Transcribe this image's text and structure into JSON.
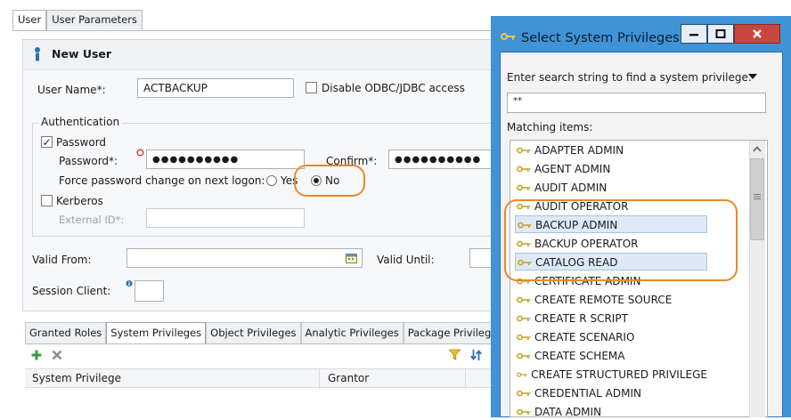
{
  "top_tabs": [
    {
      "label": "User",
      "active": true
    },
    {
      "label": "User Parameters",
      "active": false
    }
  ],
  "editor": {
    "title": "New User",
    "user_name_label": "User Name*:",
    "user_name_value": "ACTBACKUP",
    "disable_odbc_label": "Disable ODBC/JDBC access",
    "auth_group_label": "Authentication",
    "password_check_label": "Password",
    "password_label": "Password*:",
    "password_value": "●●●●●●●●●●",
    "confirm_label": "Confirm*:",
    "confirm_value": "●●●●●●●●●●",
    "force_change_label": "Force password change on next logon:",
    "yes_label": "Yes",
    "no_label": "No",
    "kerberos_label": "Kerberos",
    "external_id_label": "External ID*:",
    "valid_from_label": "Valid From:",
    "valid_until_label": "Valid Until:",
    "session_client_label": "Session Client:"
  },
  "bottom_tabs": [
    {
      "label": "Granted Roles",
      "active": false
    },
    {
      "label": "System Privileges",
      "active": true
    },
    {
      "label": "Object Privileges",
      "active": false
    },
    {
      "label": "Analytic Privileges",
      "active": false
    },
    {
      "label": "Package Privileg",
      "active": false
    }
  ],
  "grid": {
    "columns": [
      "System Privilege",
      "Grantor"
    ]
  },
  "dialog": {
    "title": "Select System Privileges",
    "search_prompt": "Enter search string to find a system privilege.",
    "search_value": "**",
    "matching_label": "Matching items:",
    "items": [
      {
        "label": "ADAPTER ADMIN",
        "selected": false
      },
      {
        "label": "AGENT ADMIN",
        "selected": false
      },
      {
        "label": "AUDIT ADMIN",
        "selected": false
      },
      {
        "label": "AUDIT OPERATOR",
        "selected": false
      },
      {
        "label": "BACKUP ADMIN",
        "selected": true
      },
      {
        "label": "BACKUP OPERATOR",
        "selected": false
      },
      {
        "label": "CATALOG READ",
        "selected": true
      },
      {
        "label": "CERTIFICATE ADMIN",
        "selected": false
      },
      {
        "label": "CREATE REMOTE SOURCE",
        "selected": false
      },
      {
        "label": "CREATE R SCRIPT",
        "selected": false
      },
      {
        "label": "CREATE SCENARIO",
        "selected": false
      },
      {
        "label": "CREATE SCHEMA",
        "selected": false
      },
      {
        "label": "CREATE STRUCTURED PRIVILEGE",
        "selected": false
      },
      {
        "label": "CREDENTIAL ADMIN",
        "selected": false
      },
      {
        "label": "DATA ADMIN",
        "selected": false
      }
    ]
  },
  "colors": {
    "dialog_frame": "#3f93d6",
    "highlight_ring": "#e8892b",
    "selection": "#dde9f6"
  }
}
